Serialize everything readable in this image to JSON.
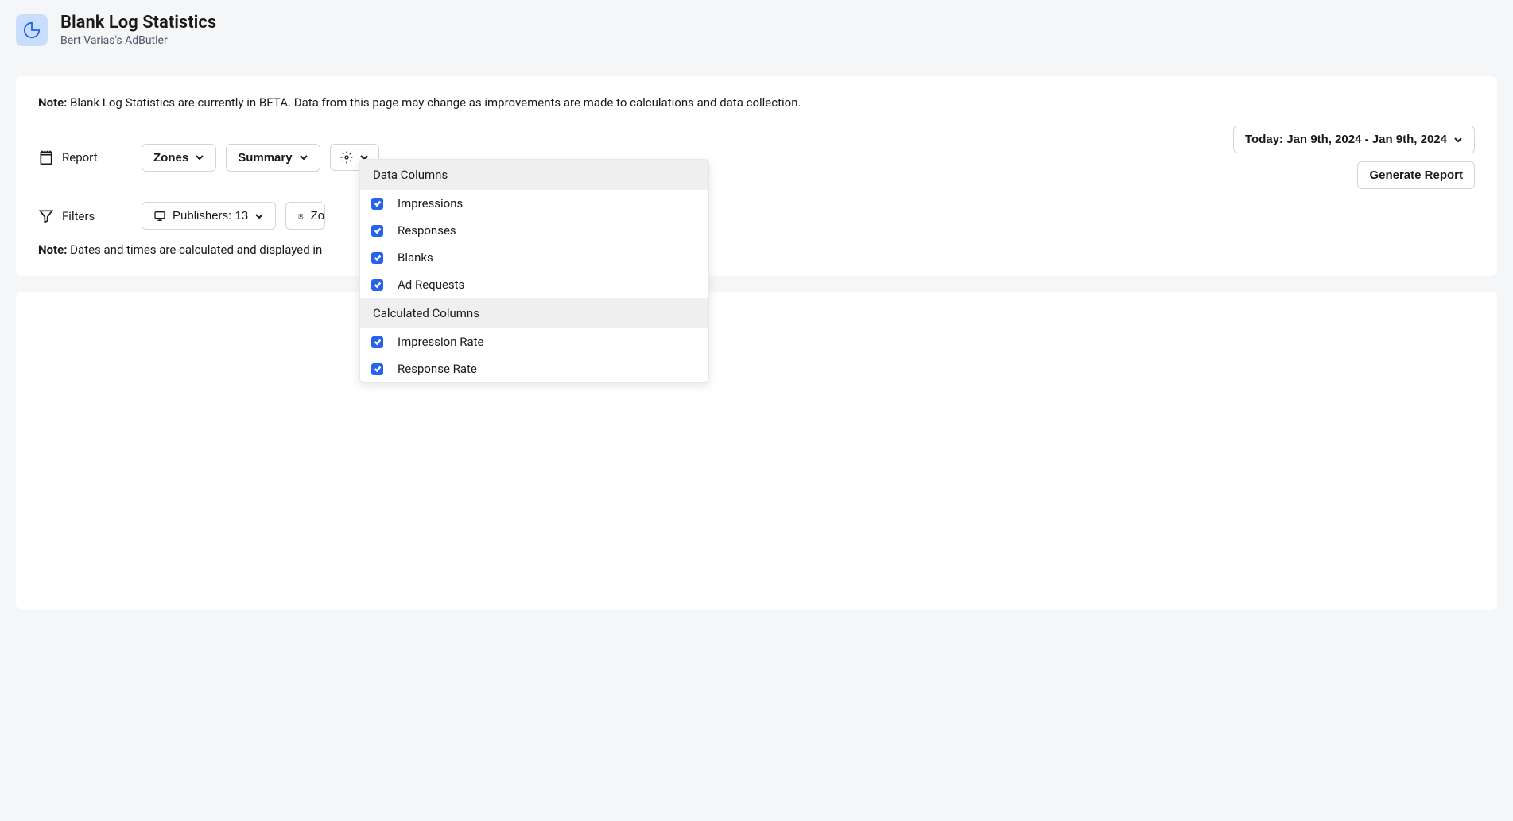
{
  "header": {
    "title": "Blank Log Statistics",
    "subtitle": "Bert Varias's AdButler"
  },
  "beta_note_label": "Note:",
  "beta_note_text": " Blank Log Statistics are currently in BETA. Data from this page may change as improvements are made to calculations and data collection.",
  "report": {
    "label": "Report",
    "zones_btn": "Zones",
    "summary_btn": "Summary"
  },
  "date_range": "Today: Jan 9th, 2024 - Jan 9th, 2024",
  "generate_btn": "Generate Report",
  "filters": {
    "label": "Filters",
    "publishers": "Publishers: 13",
    "zones_partial": "Zo"
  },
  "timezone_note_label": "Note:",
  "timezone_note_text": " Dates and times are calculated and displayed in",
  "dropdown": {
    "data_columns_header": "Data Columns",
    "calculated_columns_header": "Calculated Columns",
    "items_data": {
      "impressions": "Impressions",
      "responses": "Responses",
      "blanks": "Blanks",
      "ad_requests": "Ad Requests"
    },
    "items_calc": {
      "impression_rate": "Impression Rate",
      "response_rate": "Response Rate"
    }
  }
}
